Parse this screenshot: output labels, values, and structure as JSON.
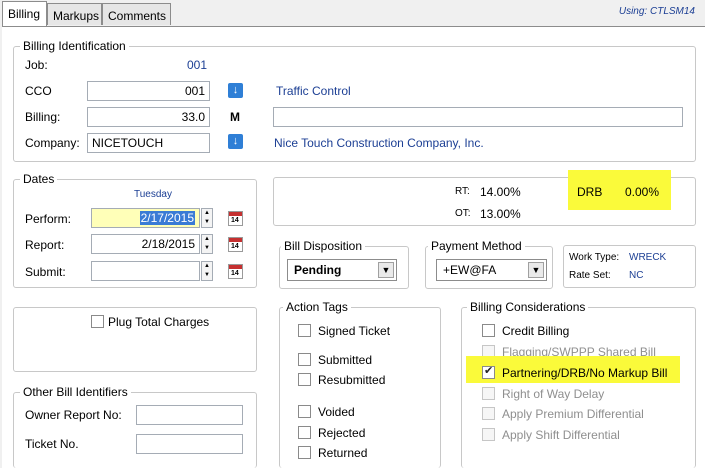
{
  "tabs": [
    {
      "label": "Billing"
    },
    {
      "label": "Markups"
    },
    {
      "label": "Comments"
    }
  ],
  "using_text": "Using: CTLSM14",
  "billing_identification": {
    "legend": "Billing Identification",
    "job_label": "Job:",
    "job_value": "001",
    "cco_label": "CCO",
    "cco_value": "001",
    "cco_desc": "Traffic Control",
    "billing_label": "Billing:",
    "billing_value": "33.0",
    "billing_flag": "M",
    "billing_desc": "",
    "company_label": "Company:",
    "company_value": "NICETOUCH",
    "company_desc": "Nice Touch Construction Company, Inc."
  },
  "dates": {
    "legend": "Dates",
    "day": "Tuesday",
    "perform_label": "Perform:",
    "perform_value": "2/17/2015",
    "report_label": "Report:",
    "report_value": "2/18/2015",
    "submit_label": "Submit:",
    "submit_value": "",
    "calendar_day": "14"
  },
  "rates": {
    "rt_label": "RT:",
    "rt_value": "14.00%",
    "ot_label": "OT:",
    "ot_value": "13.00%",
    "drb_label": "DRB",
    "drb_value": "0.00%"
  },
  "bill_disposition": {
    "legend": "Bill Disposition",
    "value": "Pending"
  },
  "payment_method": {
    "legend": "Payment Method",
    "value": "+EW@FA"
  },
  "work_info": {
    "work_type_label": "Work Type:",
    "work_type_value": "WRECK",
    "rate_set_label": "Rate Set:",
    "rate_set_value": "NC"
  },
  "plug_total_charges": "Plug Total Charges",
  "action_tags": {
    "legend": "Action Tags",
    "items": [
      "Signed Ticket",
      "Submitted",
      "Resubmitted",
      "Voided",
      "Rejected",
      "Returned"
    ]
  },
  "billing_considerations": {
    "legend": "Billing Considerations",
    "items": [
      "Credit Billing",
      "Flagging/SWPPP Shared Bill",
      "Partnering/DRB/No Markup Bill",
      "Right of Way Delay",
      "Apply Premium Differential",
      "Apply Shift Differential"
    ]
  },
  "other_bill_identifiers": {
    "legend": "Other Bill Identifiers",
    "owner_report_label": "Owner Report No:",
    "owner_report_value": "",
    "ticket_label": "Ticket No.",
    "ticket_value": ""
  },
  "colors": {
    "highlight": "#fafa3a",
    "link_blue": "#1c3f94",
    "accent": "#2f7fd6"
  }
}
